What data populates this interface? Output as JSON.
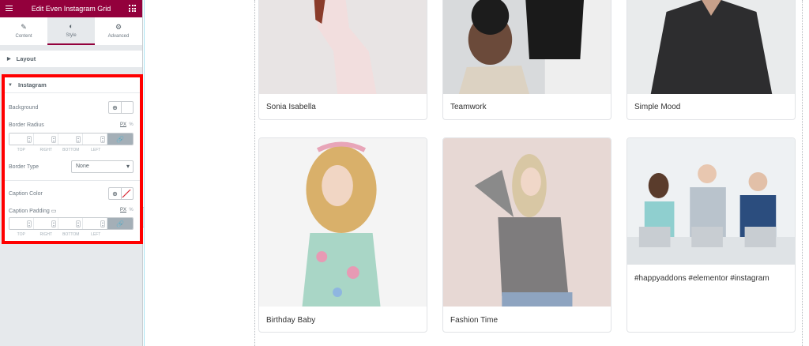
{
  "panel": {
    "title": "Edit Even Instagram Grid",
    "tabs": [
      {
        "label": "Content",
        "icon": "pencil-icon"
      },
      {
        "label": "Style",
        "icon": "half-circle-icon"
      },
      {
        "label": "Advanced",
        "icon": "gear-icon"
      }
    ],
    "sections": {
      "layout": "Layout",
      "instagram": "Instagram"
    },
    "controls": {
      "background": "Background",
      "border_radius": "Border Radius",
      "unit_px": "PX",
      "unit_pct": "%",
      "dims": [
        "TOP",
        "RIGHT",
        "BOTTOM",
        "LEFT"
      ],
      "border_type": "Border Type",
      "border_type_value": "None",
      "caption_color": "Caption Color",
      "caption_padding": "Caption Padding"
    }
  },
  "grid": {
    "captions": [
      "Sonia Isabella",
      "Teamwork",
      "Simple Mood",
      "Birthday Baby",
      "Fashion Time",
      "#happyaddons #elementor #instagram"
    ]
  },
  "colors": {
    "header": "#93003c",
    "highlight": "#ff0000"
  }
}
